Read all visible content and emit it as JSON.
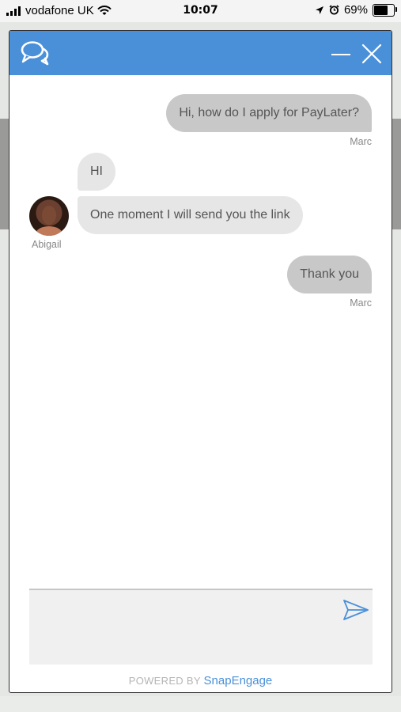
{
  "status_bar": {
    "carrier": "vodafone UK",
    "time": "10:07",
    "battery_percent": "69%",
    "battery_level": 0.69,
    "icons": [
      "signal-bars-icon",
      "wifi-icon",
      "location-arrow-icon",
      "alarm-clock-icon",
      "battery-icon"
    ]
  },
  "header": {
    "logo_icon": "chat-bubbles-icon",
    "minimize_icon": "minimize-icon",
    "close_icon": "close-icon",
    "color": "#4a90d9"
  },
  "messages": [
    {
      "direction": "out",
      "text": "Hi, how do I apply for PayLater?",
      "sender": "Marc"
    },
    {
      "direction": "in",
      "text": "HI"
    },
    {
      "direction": "in",
      "text": "One moment I will send you the link",
      "sender": "Abigail"
    },
    {
      "direction": "out",
      "text": "Thank you",
      "sender": "Marc"
    }
  ],
  "composer": {
    "value": "",
    "placeholder": "",
    "send_icon": "send-paper-plane-icon"
  },
  "footer": {
    "powered_by": "POWERED BY",
    "brand": "SnapEngage"
  }
}
